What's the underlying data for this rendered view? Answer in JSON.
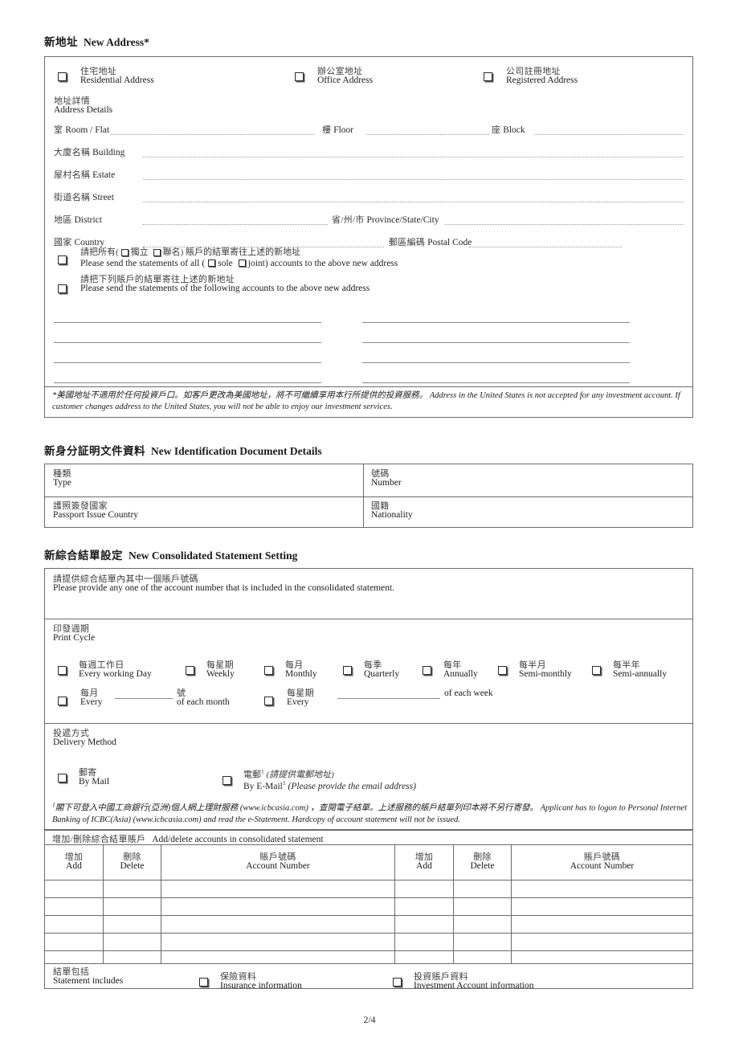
{
  "sections": {
    "new_address": {
      "cn": "新地址",
      "en": "New Address*"
    },
    "new_id": {
      "cn": "新身分証明文件資料",
      "en": "New Identification Document Details"
    },
    "new_stmt": {
      "cn": "新綜合結單設定",
      "en": "New Consolidated Statement Setting"
    }
  },
  "address": {
    "types": [
      {
        "cn": "住宅地址",
        "en": "Residential Address"
      },
      {
        "cn": "辦公室地址",
        "en": "Office Address"
      },
      {
        "cn": "公司註冊地址",
        "en": "Registered Address"
      }
    ],
    "details_label": {
      "cn": "地址詳情",
      "en": "Address Details"
    },
    "fields": {
      "room": {
        "cn": "室",
        "en": "Room / Flat"
      },
      "floor": {
        "cn": "樓",
        "en": "Floor"
      },
      "block": {
        "cn": "座",
        "en": "Block"
      },
      "building": {
        "cn": "大廈名稱",
        "en": "Building"
      },
      "estate": {
        "cn": "屋村名稱",
        "en": "Estate"
      },
      "street": {
        "cn": "街道名稱",
        "en": "Street"
      },
      "district": {
        "cn": "地區",
        "en": "District"
      },
      "province": {
        "cn": "省/州/市",
        "en": "Province/State/City"
      },
      "country": {
        "cn": "國家",
        "en": "Country"
      },
      "postal": {
        "cn": "郵區編碼",
        "en": "Postal Code"
      }
    },
    "option_all": {
      "cn_a": "請把所有(",
      "cn_sole": "獨立",
      "cn_joint": "聯名",
      "cn_b": ") 賬戶的結單寄往上述的新地址",
      "en_a": "Please send the statements of all (",
      "en_sole": "sole",
      "en_joint": "joint",
      "en_b": ") accounts to the above new address"
    },
    "option_following": {
      "cn": "請把下列賬戶的結單寄往上述的新地址",
      "en": "Please send the statements of the following accounts to the above new address"
    },
    "footnote": {
      "cn": "*美國地址不適用於任何投資戶口。如客戶更改為美國地址，將不可繼續享用本行所提供的投資服務。",
      "en": "Address in the United States is not accepted for any investment account. If customer changes address to the United States, you will not be able to enjoy our investment services."
    }
  },
  "identification": {
    "cells": [
      {
        "cn": "種類",
        "en": "Type"
      },
      {
        "cn": "號碼",
        "en": "Number"
      },
      {
        "cn": "護照簽發國家",
        "en": "Passport Issue Country"
      },
      {
        "cn": "國籍",
        "en": "Nationality"
      }
    ]
  },
  "statement": {
    "provide_note": {
      "cn": "請提供綜合結單內其中一個賬戶號碼",
      "en": "Please provide any one of the account number that is included in the consolidated statement."
    },
    "print_cycle_label": {
      "cn": "印發週期",
      "en": "Print Cycle"
    },
    "cycles": [
      {
        "cn": "每週工作日",
        "en": "Every working Day"
      },
      {
        "cn": "每星期",
        "en": "Weekly"
      },
      {
        "cn": "每月",
        "en": "Monthly"
      },
      {
        "cn": "每季",
        "en": "Quarterly"
      },
      {
        "cn": "每年",
        "en": "Annually"
      },
      {
        "cn": "每半月",
        "en": "Semi-monthly"
      },
      {
        "cn": "每半年",
        "en": "Semi-annually"
      }
    ],
    "every_month": {
      "cn_pre": "每月",
      "en_pre": "Every",
      "cn_post": "號",
      "en_post": "of each month"
    },
    "every_week": {
      "cn_pre": "每星期",
      "en_pre": "Every",
      "cn_post": "",
      "en_post": "of each week"
    },
    "delivery_label": {
      "cn": "投遞方式",
      "en": "Delivery Method"
    },
    "delivery": [
      {
        "cn": "郵寄",
        "en": "By Mail",
        "cn_note": "",
        "en_note": ""
      },
      {
        "cn": "電郵",
        "en": "By E-Mail",
        "cn_note": "(請提供電郵地址)",
        "en_note": "(Please provide the email address)"
      }
    ],
    "email_footnote": {
      "cn": "閣下可登入中國工商銀行(亞洲)個人網上理財服務 (www.icbcasia.com) ，查閱電子結單。上述服務的賬戶結單列印本將不另行寄發。",
      "en": "Applicant has to logon to Personal Internet Banking of ICBC(Asia) (www.icbcasia.com) and read the e-Statement. Hardcopy of account statement will not be issued."
    },
    "table_title": {
      "cn": "增加/刪除綜合結單賬戶",
      "en": "Add/delete accounts in consolidated statement"
    },
    "table_headers": [
      {
        "cn": "增加",
        "en": "Add"
      },
      {
        "cn": "刪除",
        "en": "Delete"
      },
      {
        "cn": "賬戶號碼",
        "en": "Account Number"
      },
      {
        "cn": "增加",
        "en": "Add"
      },
      {
        "cn": "刪除",
        "en": "Delete"
      },
      {
        "cn": "賬戶號碼",
        "en": "Account Number"
      }
    ],
    "table_rows": [
      [
        "",
        "",
        "",
        "",
        "",
        ""
      ],
      [
        "",
        "",
        "",
        "",
        "",
        ""
      ],
      [
        "",
        "",
        "",
        "",
        "",
        ""
      ],
      [
        "",
        "",
        "",
        "",
        "",
        ""
      ],
      [
        "",
        "",
        "",
        "",
        "",
        ""
      ]
    ],
    "includes_label": {
      "cn": "結單包括",
      "en": "Statement includes"
    },
    "includes": [
      {
        "cn": "保險資料",
        "en": "Insurance information"
      },
      {
        "cn": "投資賬戶資料",
        "en": "Investment Account information"
      }
    ]
  },
  "page_number": "2/4"
}
